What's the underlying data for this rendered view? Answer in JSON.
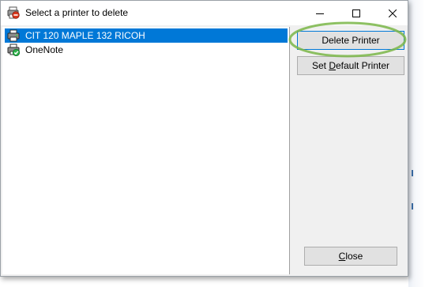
{
  "window": {
    "title": "Select a printer to delete",
    "app_icon": "printer-delete-icon",
    "caption_buttons": {
      "minimize_icon": "minimize-icon",
      "maximize_icon": "maximize-icon",
      "close_icon": "close-icon"
    }
  },
  "printer_list": {
    "selected_index": 0,
    "items": [
      {
        "label": "CIT 120 MAPLE 132 RICOH",
        "icon": "printer-icon",
        "selected": true
      },
      {
        "label": "OneNote",
        "icon": "default-printer-check-icon",
        "selected": false
      }
    ]
  },
  "buttons": {
    "delete_printer": "Delete Printer",
    "set_default_prefix": "Set ",
    "set_default_accel": "D",
    "set_default_suffix": "efault Printer",
    "close_accel": "C",
    "close_suffix": "lose"
  },
  "colors": {
    "selection": "#0078d7",
    "highlight_ring": "#7ab648",
    "button_face": "#e1e1e1"
  }
}
